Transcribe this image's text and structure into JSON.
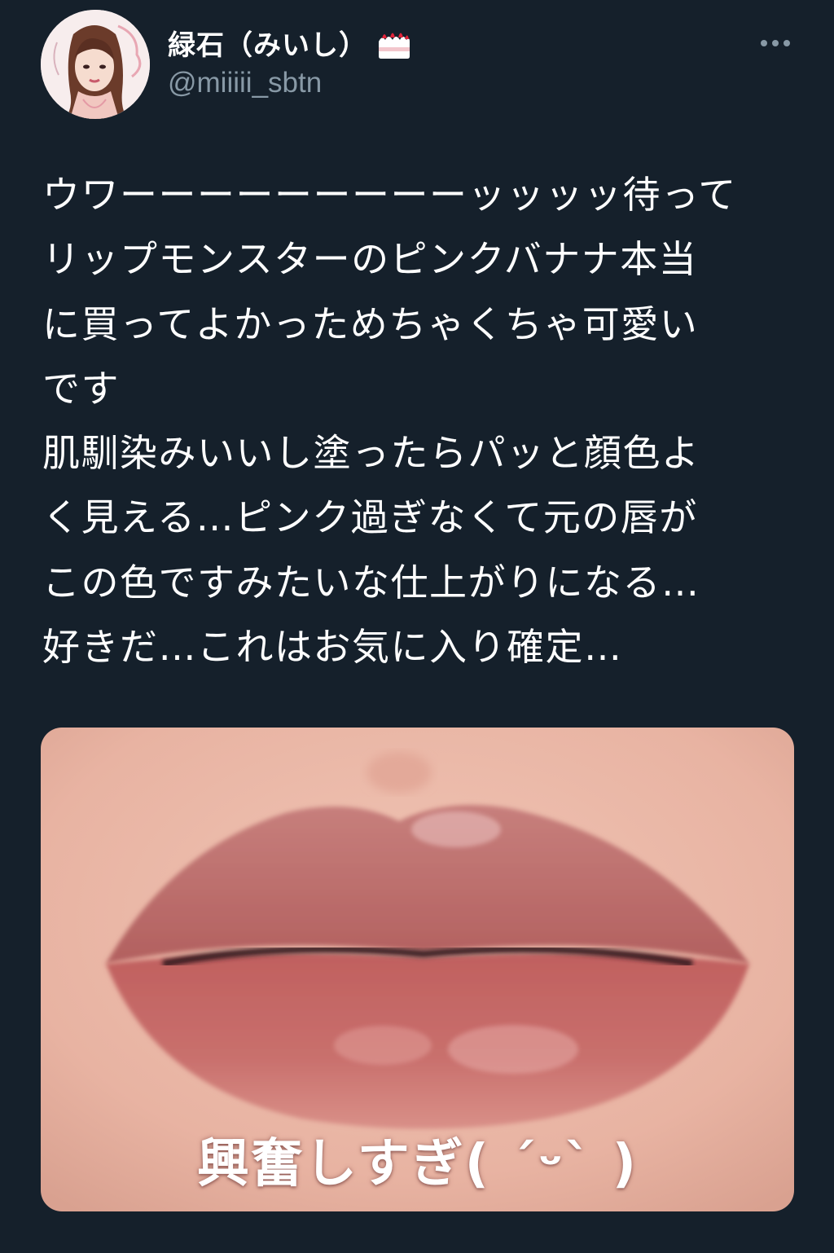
{
  "theme": {
    "background": "#15202b",
    "text_primary": "#ffffff",
    "text_secondary": "#8899a6"
  },
  "author": {
    "display_name": "緑石（みいし）",
    "badge_icon": "shortcake-emoji-icon",
    "handle": "@miiiii_sbtn",
    "avatar_icon": "illustrated-woman-avatar"
  },
  "more_icon": "more-horizontal-icon",
  "tweet": {
    "lines": [
      "ウワーーーーーーーーーッッッッ待って",
      "リップモンスターのピンクバナナ本当",
      "に買ってよかっためちゃくちゃ可愛い",
      "です",
      "肌馴染みいいし塗ったらパッと顔色よ",
      "く見える…ピンク過ぎなくて元の唇が",
      "この色ですみたいな仕上がりになる…",
      "好きだ…これはお気に入り確定…"
    ]
  },
  "media": {
    "caption": "興奮しすぎ( ˊᵕˋ )",
    "subject": "lips-photo"
  }
}
